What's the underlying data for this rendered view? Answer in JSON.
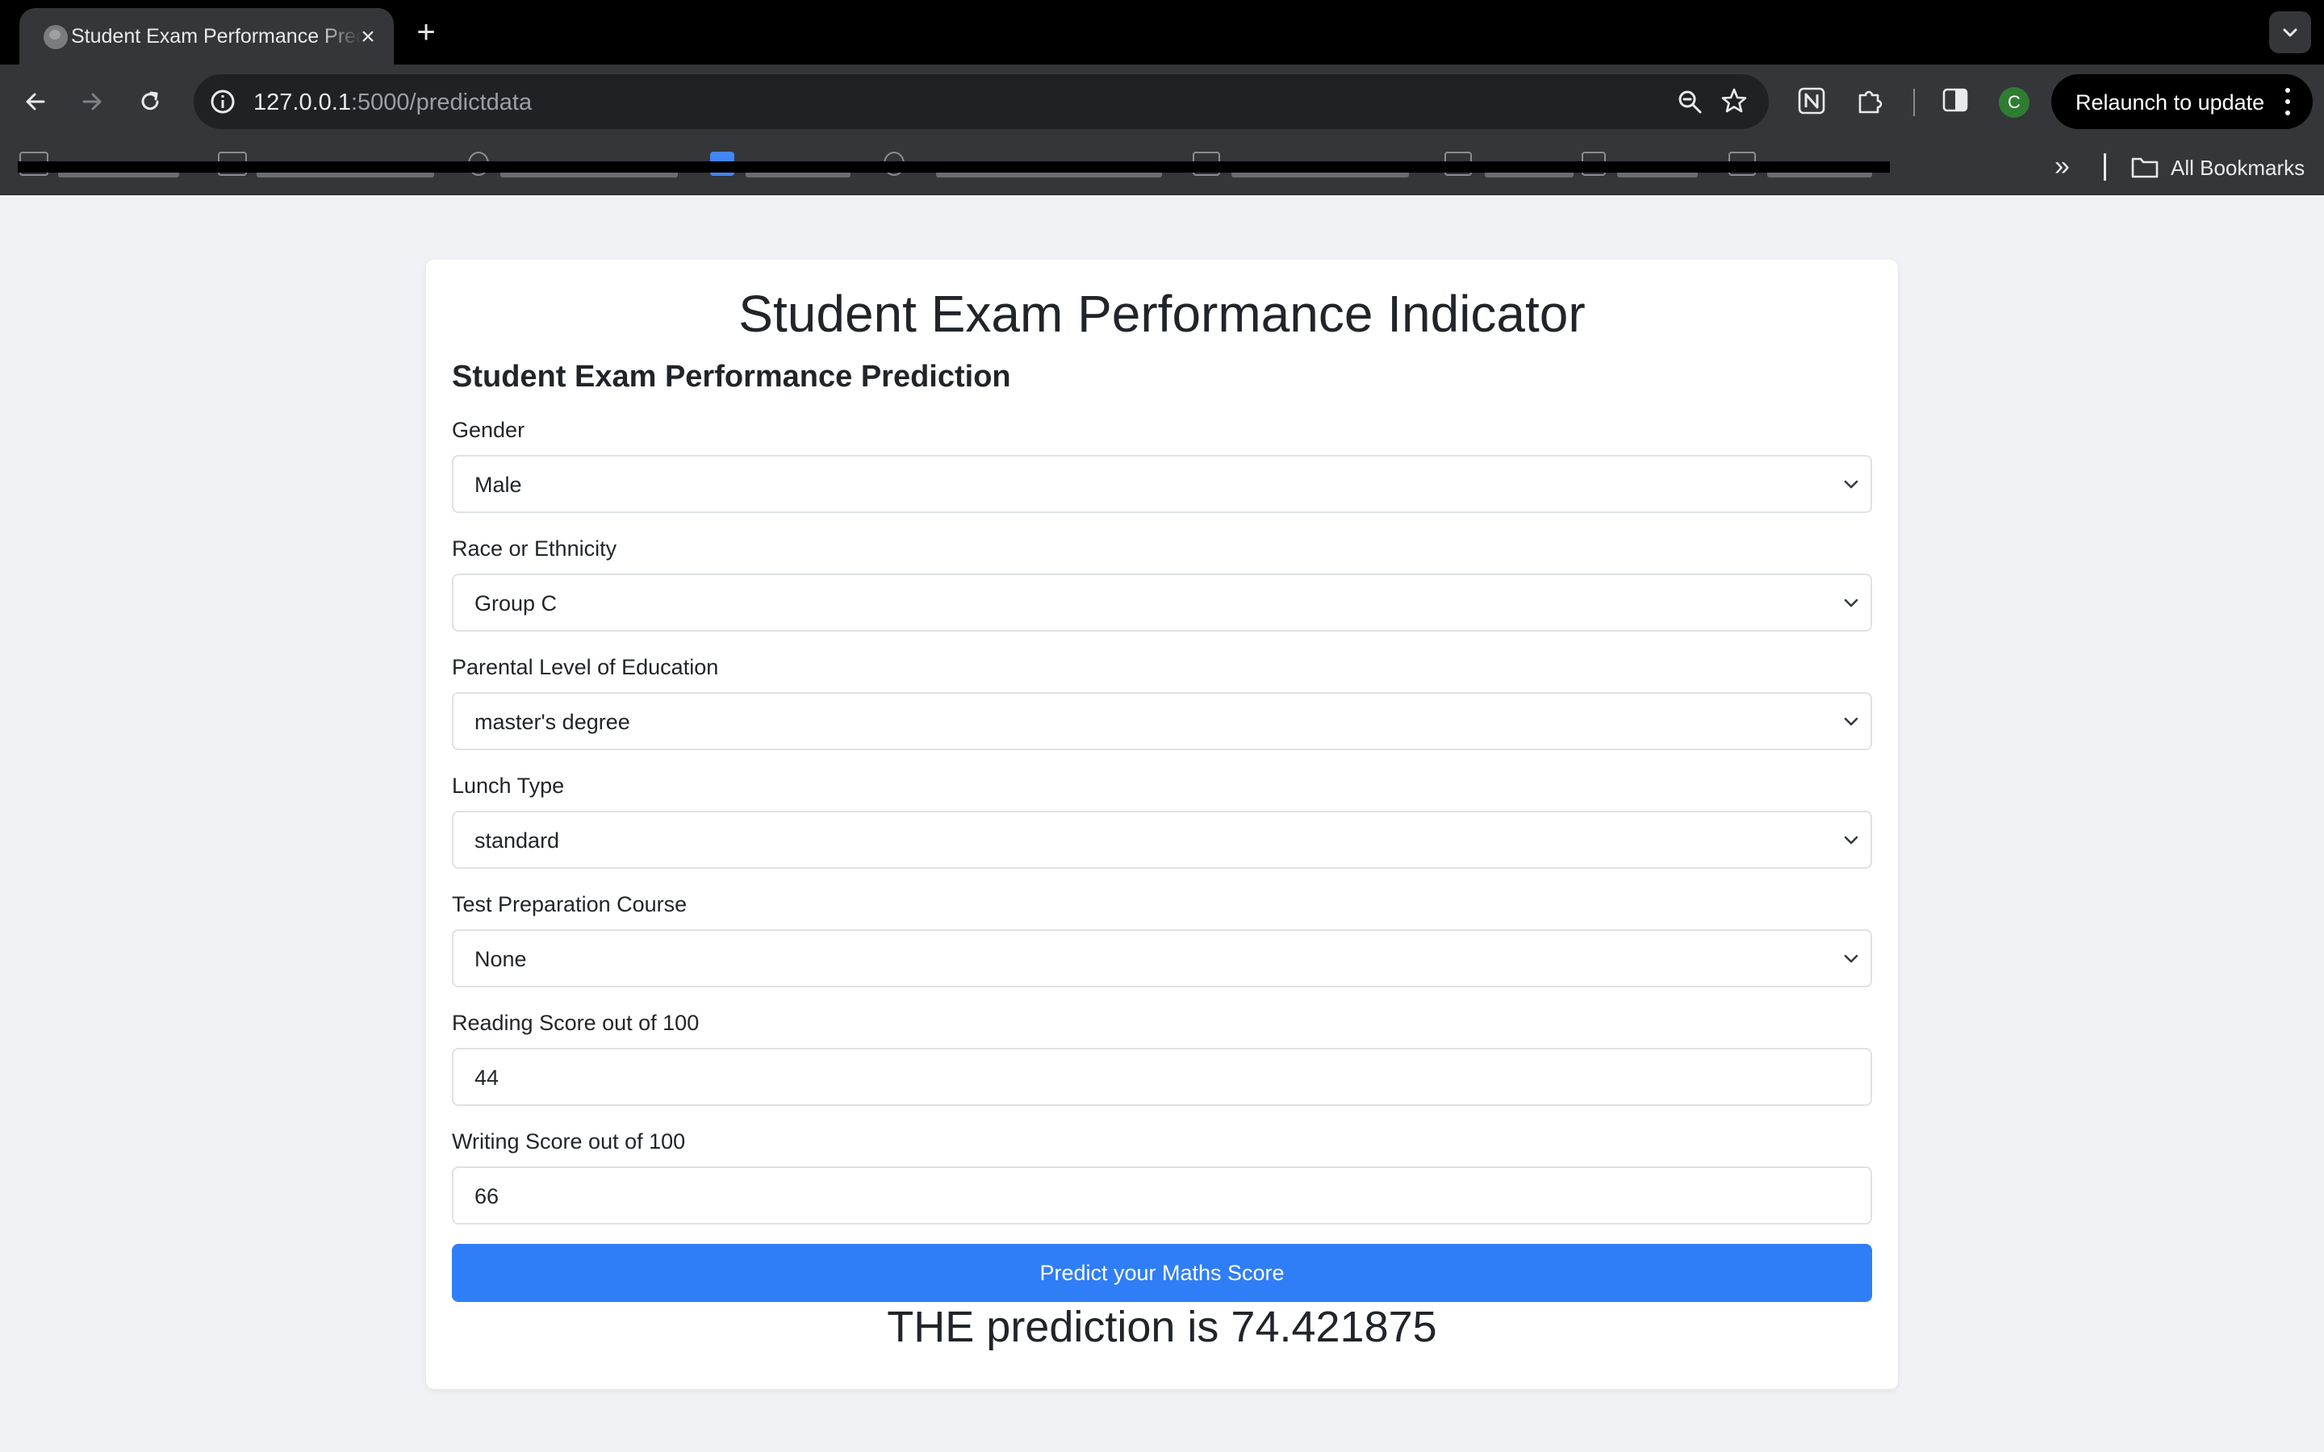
{
  "browser": {
    "tab_title": "Student Exam Performance Prediction",
    "url_host": "127.0.0.1",
    "url_rest": ":5000/predictdata",
    "relaunch_label": "Relaunch to update",
    "avatar_letter": "C",
    "all_bookmarks_label": "All Bookmarks",
    "overflow_chevron": "»",
    "new_tab_symbol": "+",
    "close_symbol": "×"
  },
  "page": {
    "title": "Student Exam Performance Indicator",
    "form_title": "Student Exam Performance Prediction",
    "fields": {
      "gender": {
        "label": "Gender",
        "value": "Male"
      },
      "race": {
        "label": "Race or Ethnicity",
        "value": "Group C"
      },
      "parental_education": {
        "label": "Parental Level of Education",
        "value": "master's degree"
      },
      "lunch": {
        "label": "Lunch Type",
        "value": "standard"
      },
      "test_prep": {
        "label": "Test Preparation Course",
        "value": "None"
      },
      "reading": {
        "label": "Reading Score out of 100",
        "value": "44"
      },
      "writing": {
        "label": "Writing Score out of 100",
        "value": "66"
      }
    },
    "submit_label": "Predict your Maths Score",
    "result": "THE prediction is 74.421875"
  }
}
